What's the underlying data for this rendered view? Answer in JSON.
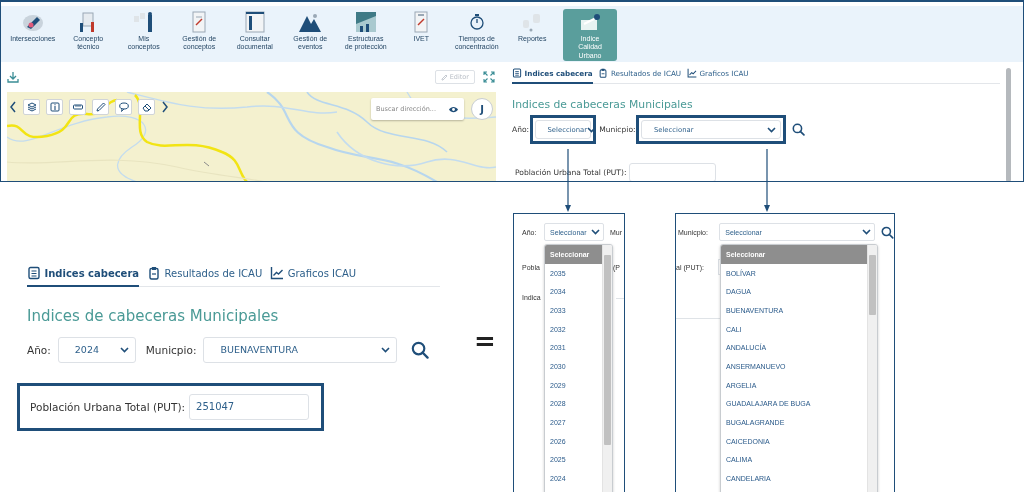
{
  "toolbar": {
    "items": [
      {
        "label": "Intersecciones",
        "selected": false
      },
      {
        "label": "Concepto técnico",
        "selected": false
      },
      {
        "label": "Mis conceptos",
        "selected": false
      },
      {
        "label": "Gestión de conceptos",
        "selected": false
      },
      {
        "label": "Consultar documental",
        "selected": false
      },
      {
        "label": "Gestión de eventos",
        "selected": false
      },
      {
        "label": "Estructuras de protección",
        "selected": false
      },
      {
        "label": "IVET",
        "selected": false
      },
      {
        "label": "Tiempos de concentración",
        "selected": false
      },
      {
        "label": "Reportes",
        "selected": false
      },
      {
        "label": "Indice Calidad Urbano",
        "selected": true
      }
    ]
  },
  "map_panel": {
    "editor_button": {
      "label": "Editor",
      "disabled": true
    },
    "search": {
      "placeholder": "Buscar dirección..."
    },
    "user_avatar": "J"
  },
  "icau_panel": {
    "tabs": [
      {
        "label": "Indices cabecera",
        "selected": true
      },
      {
        "label": "Resultados de ICAU",
        "selected": false
      },
      {
        "label": "Graficos ICAU",
        "selected": false
      }
    ],
    "heading": "Indices de cabeceras Municipales",
    "year": {
      "label": "Año:",
      "value": "Seleccionar",
      "highlighted": true
    },
    "municipality": {
      "label": "Municpio:",
      "value": "Seleccionar",
      "highlighted": true
    },
    "population": {
      "label": "Población Urbana Total (PUT):",
      "highlighted": false
    }
  },
  "filled_example": {
    "tabs": [
      {
        "label": "Indices cabecera",
        "selected": true
      },
      {
        "label": "Resultados de ICAU",
        "selected": false
      },
      {
        "label": "Graficos ICAU",
        "selected": false
      }
    ],
    "heading": "Indices de cabeceras Municipales",
    "year": {
      "label": "Año:",
      "value": "2024",
      "highlighted": false
    },
    "municipality": {
      "label": "Municpio:",
      "value": "BUENAVENTURA",
      "highlighted": false
    },
    "population": {
      "label": "Población Urbana Total (PUT):",
      "value": "251047",
      "highlighted": true
    }
  },
  "equals_sign": "=",
  "year_dropdown": {
    "label": "Año:",
    "value": "Seleccionar",
    "next_label": "Mur",
    "row_2_label": "Pobla",
    "row_2_suffix": "(P",
    "row_3_label": "Indica",
    "options": [
      {
        "label": "Seleccionar",
        "selected": true
      },
      {
        "label": "2035",
        "selected": false
      },
      {
        "label": "2034",
        "selected": false
      },
      {
        "label": "2033",
        "selected": false
      },
      {
        "label": "2032",
        "selected": false
      },
      {
        "label": "2031",
        "selected": false
      },
      {
        "label": "2030",
        "selected": false
      },
      {
        "label": "2029",
        "selected": false
      },
      {
        "label": "2028",
        "selected": false
      },
      {
        "label": "2027",
        "selected": false
      },
      {
        "label": "2026",
        "selected": false
      },
      {
        "label": "2025",
        "selected": false
      },
      {
        "label": "2024",
        "selected": false
      }
    ]
  },
  "municipality_dropdown": {
    "label": "Municpio:",
    "value": "Seleccionar",
    "row_2_label": "al (PUT):",
    "options": [
      {
        "label": "Seleccionar",
        "selected": true
      },
      {
        "label": "BOLÍVAR",
        "selected": false
      },
      {
        "label": "DAGUA",
        "selected": false
      },
      {
        "label": "BUENAVENTURA",
        "selected": false
      },
      {
        "label": "CALI",
        "selected": false
      },
      {
        "label": "ANDALUCÍA",
        "selected": false
      },
      {
        "label": "ANSERMANUEVO",
        "selected": false
      },
      {
        "label": "ARGELIA",
        "selected": false
      },
      {
        "label": "GUADALAJARA DE BUGA",
        "selected": false
      },
      {
        "label": "BUGALAGRANDE",
        "selected": false
      },
      {
        "label": "CAICEDONIA",
        "selected": false
      },
      {
        "label": "CALIMA",
        "selected": false
      },
      {
        "label": "CANDELARIA",
        "selected": false
      }
    ]
  }
}
